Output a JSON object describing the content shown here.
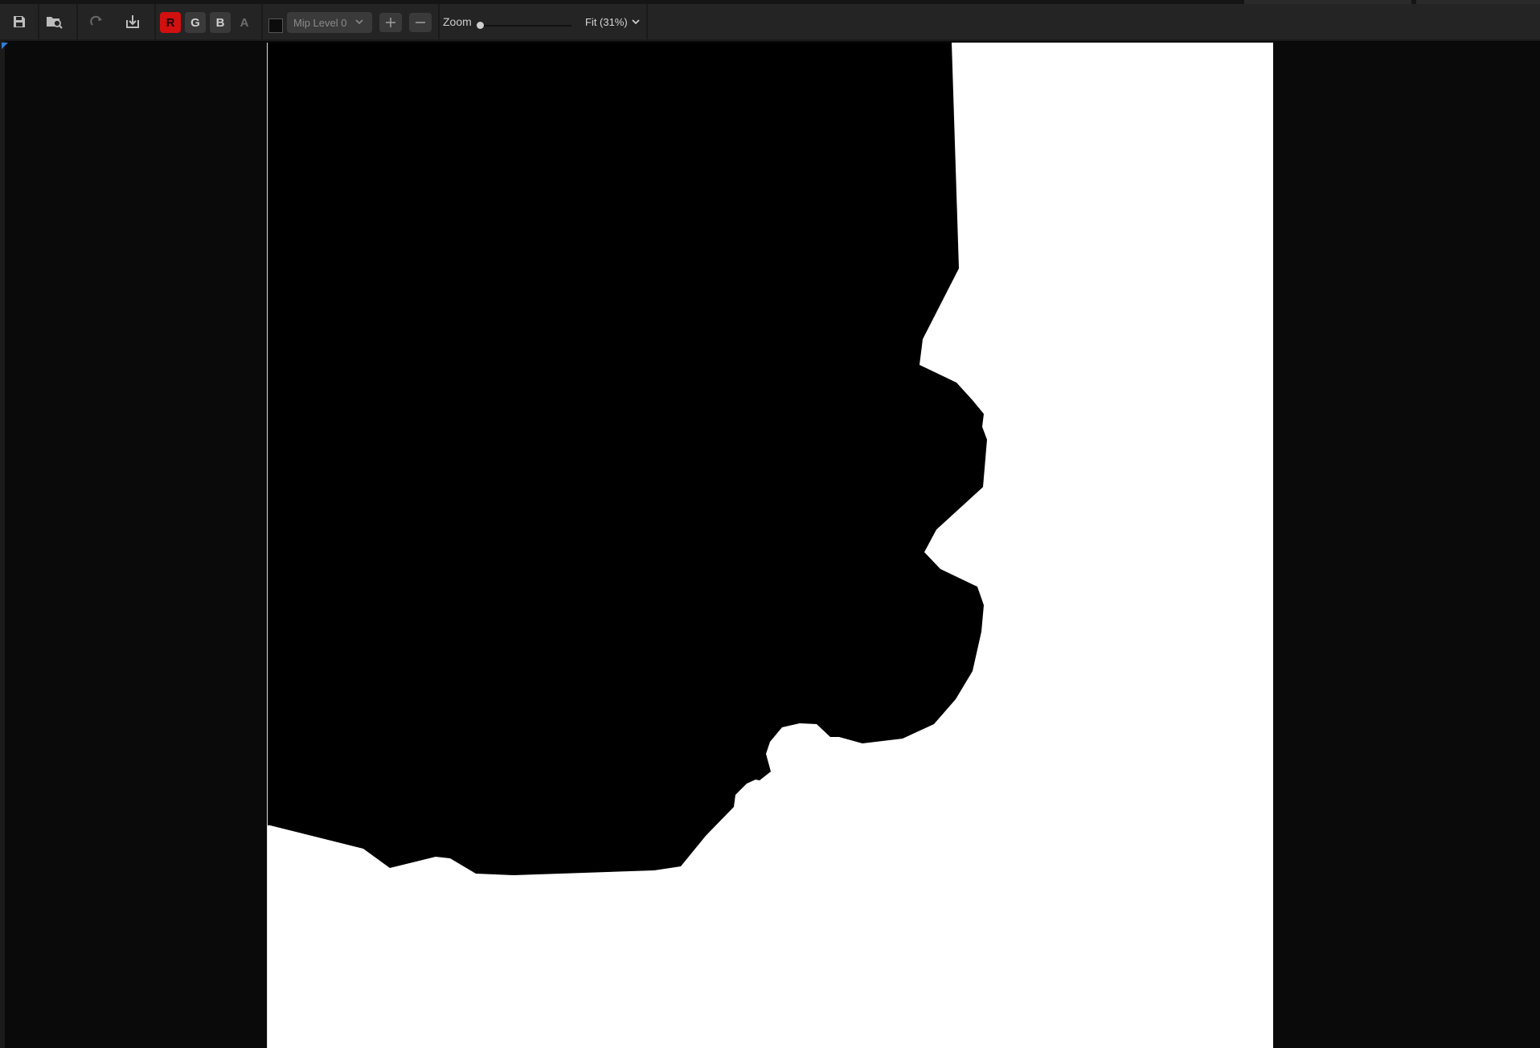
{
  "toolbar": {
    "save_icon": "save-icon",
    "browse_icon": "browse-in-content-icon",
    "reimport_icon": "reimport-icon",
    "import_icon": "import-icon",
    "channels": {
      "r": "R",
      "g": "G",
      "b": "B",
      "a": "A"
    },
    "channel_active_color": "#d21010",
    "mip_level": "Mip Level 0",
    "zoom_in_icon": "plus-icon",
    "zoom_out_icon": "minus-icon",
    "zoom_label": "Zoom",
    "zoom_slider_value": 0.0,
    "fit_label": "Fit (31%)"
  },
  "viewport": {
    "texture_colors": {
      "mask": "#000000",
      "background": "#ffffff"
    }
  }
}
